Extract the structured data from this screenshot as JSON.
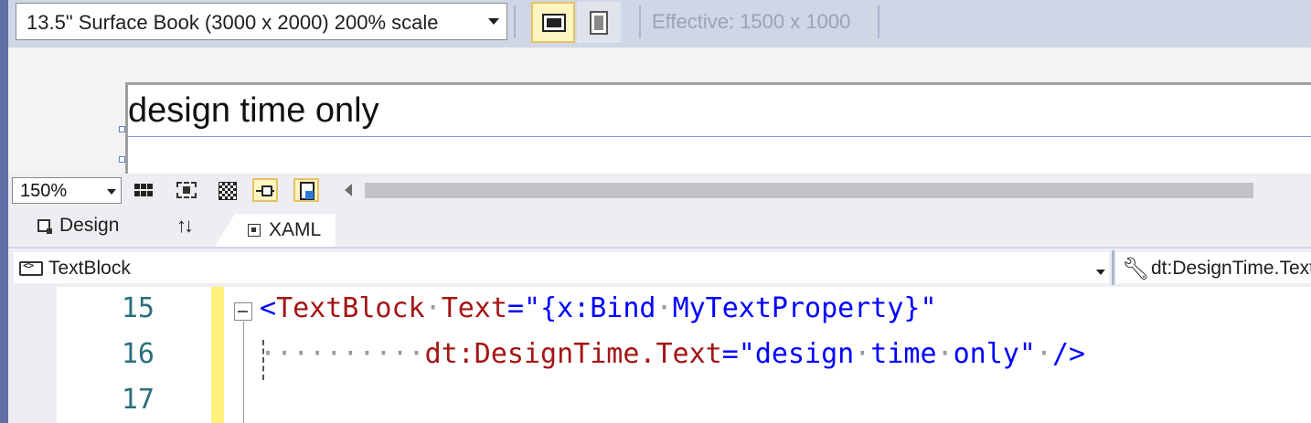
{
  "top_toolbar": {
    "device": "13.5\" Surface Book (3000 x 2000) 200% scale",
    "effective": "Effective: 1500 x 1000"
  },
  "design_surface": {
    "preview_text": "design time only"
  },
  "zoom_toolbar": {
    "zoom": "150%"
  },
  "tabs": {
    "design": "Design",
    "swap": "↑↓",
    "xaml": "XAML"
  },
  "nav": {
    "element": "TextBlock",
    "member": "dt:DesignTime.Text"
  },
  "editor": {
    "line_numbers": [
      "15",
      "16",
      "17"
    ],
    "line15": {
      "open": "<",
      "tag": "TextBlock",
      "dot1": "·",
      "attr": "Text",
      "eq": "=\"",
      "val1": "{x:Bind",
      "dot2": "·",
      "val2": "MyTextProperty}",
      "close": "\""
    },
    "line16": {
      "indent": "··········",
      "attr": "dt:DesignTime.Text",
      "eq": "=\"",
      "val1": "design",
      "dot1": "·",
      "val2": "time",
      "dot2": "·",
      "val3": "only",
      "close": "\"",
      "dot3": "·",
      "end": "/>"
    }
  },
  "colors": {
    "accent_left": "#5e6fa3",
    "toolbar_bg": "#cfd6e5",
    "active_btn": "#fdf4bf",
    "change_bar": "#fff17a",
    "xml_tag": "#a31515",
    "xml_value": "#0000ff",
    "line_number": "#2b6f7c"
  }
}
